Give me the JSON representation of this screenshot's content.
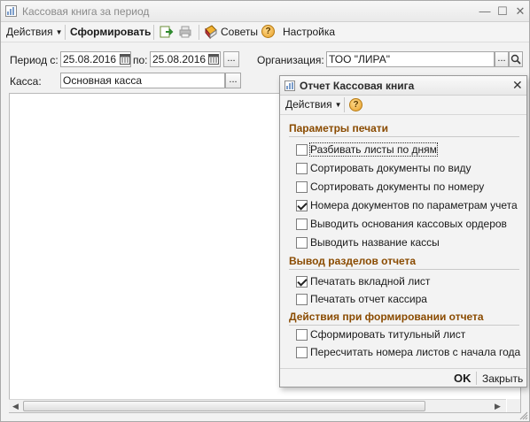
{
  "window": {
    "title": "Кассовая книга за период"
  },
  "toolbar": {
    "actions_label": "Действия",
    "generate_label": "Сформировать",
    "tips_label": "Советы",
    "settings_label": "Настройка"
  },
  "form": {
    "period_from_label": "Период с:",
    "period_from_value": "25.08.2016",
    "period_to_label": "по:",
    "period_to_value": "25.08.2016",
    "ellipsis": "...",
    "org_label": "Организация:",
    "org_value": "ТОО \"ЛИРА\"",
    "kassa_label": "Касса:",
    "kassa_value": "Основная касса"
  },
  "dialog": {
    "title": "Отчет  Кассовая книга",
    "actions_label": "Действия",
    "sections": [
      {
        "title": "Параметры печати",
        "items": [
          {
            "label": "Разбивать листы по дням",
            "checked": false
          },
          {
            "label": "Сортировать документы по виду",
            "checked": false
          },
          {
            "label": "Сортировать документы по номеру",
            "checked": false
          },
          {
            "label": "Номера документов по параметрам учета",
            "checked": true
          },
          {
            "label": "Выводить основания кассовых ордеров",
            "checked": false
          },
          {
            "label": "Выводить название кассы",
            "checked": false
          }
        ]
      },
      {
        "title": "Вывод разделов отчета",
        "items": [
          {
            "label": "Печатать вкладной лист",
            "checked": true
          },
          {
            "label": "Печатать отчет кассира",
            "checked": false
          }
        ]
      },
      {
        "title": "Действия при формировании отчета",
        "items": [
          {
            "label": "Сформировать титульный лист",
            "checked": false
          },
          {
            "label": "Пересчитать номера листов с начала года",
            "checked": false
          }
        ]
      }
    ],
    "ok_label": "OK",
    "close_label": "Закрыть"
  },
  "colors": {
    "section_title": "#8a4b00",
    "window_bg": "#f2f2f2"
  }
}
